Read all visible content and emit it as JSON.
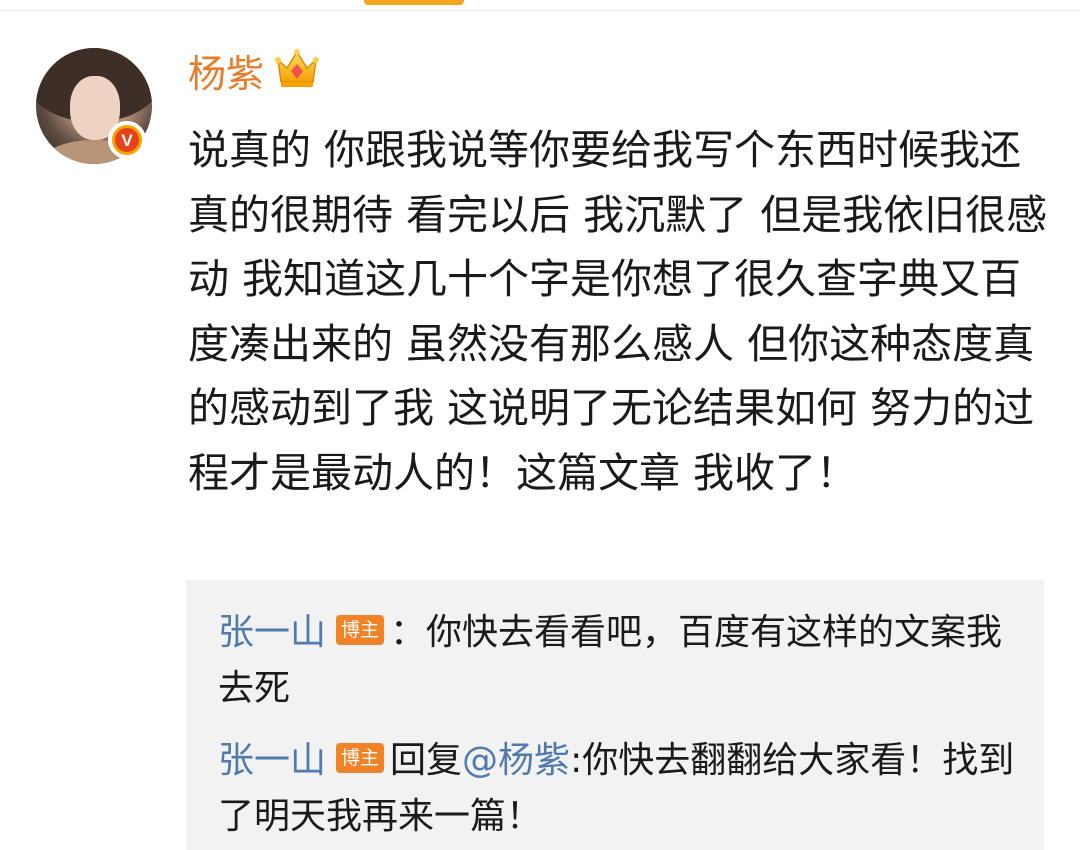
{
  "post": {
    "username": "杨紫",
    "text": "说真的 你跟我说等你要给我写个东西时候我还真的很期待 看完以后 我沉默了 但是我依旧很感动 我知道这几十个字是你想了很久查字典又百度凑出来的 虽然没有那么感人 但你这种态度真的感动到了我 这说明了无论结果如何 努力的过程才是最动人的！这篇文章 我收了！",
    "verified_badge": "V",
    "icons": {
      "avatar": "user-avatar",
      "verified": "verified-v-badge-icon",
      "vip": "crown-vip-icon"
    }
  },
  "replies": [
    {
      "author": "张一山",
      "tag": "博主",
      "separator": "：",
      "text": "你快去看看吧，百度有这样的文案我去死"
    },
    {
      "author": "张一山",
      "tag": "博主",
      "prefix": "回复",
      "mention": "@杨紫",
      "separator": ":",
      "text": "你快去翻翻给大家看！找到了明天我再来一篇！"
    }
  ],
  "colors": {
    "username": "#e77c2a",
    "reply_name": "#4f7cac",
    "tag_bg": "#f08326",
    "reply_box_bg": "#f2f2f2",
    "text": "#1a1a1a"
  }
}
